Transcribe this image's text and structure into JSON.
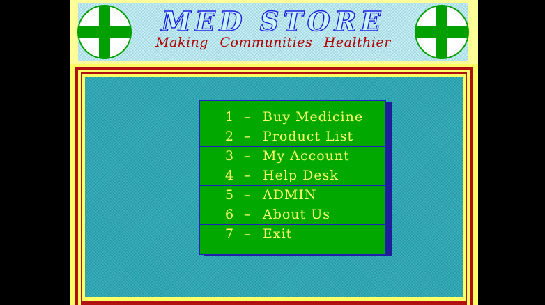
{
  "header": {
    "title": "MED STORE",
    "tagline": "Making Communities Healthier"
  },
  "colors": {
    "background": "#000000",
    "header_bg": "#c8f4f6",
    "title_outline": "#1a1ae0",
    "tagline": "#b00000",
    "frame_yellow": "#ffff66",
    "frame_red": "#b01010",
    "panel": "#2ba8b4",
    "menu_bg": "#00a800",
    "menu_text": "#ffff66",
    "menu_border": "#2020c0",
    "cross": "#00a000"
  },
  "icons": {
    "left": "medical-cross-icon",
    "right": "medical-cross-icon"
  },
  "menu": {
    "separator": "–",
    "items": [
      {
        "key": "1",
        "label": "Buy Medicine"
      },
      {
        "key": "2",
        "label": "Product List"
      },
      {
        "key": "3",
        "label": "My Account"
      },
      {
        "key": "4",
        "label": "Help Desk"
      },
      {
        "key": "5",
        "label": "ADMIN"
      },
      {
        "key": "6",
        "label": "About Us"
      },
      {
        "key": "7",
        "label": "Exit"
      }
    ]
  }
}
